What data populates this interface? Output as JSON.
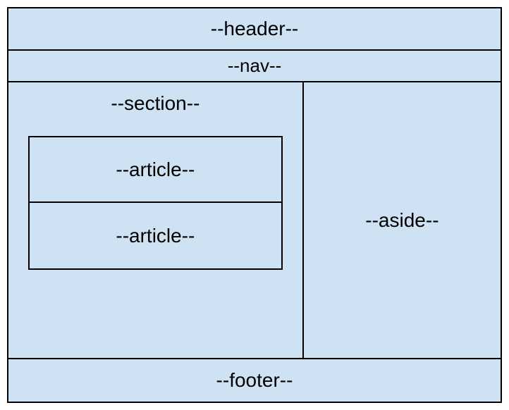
{
  "layout": {
    "header": "--header--",
    "nav": "--nav--",
    "section": {
      "title": "--section--",
      "articles": [
        "--article--",
        "--article--"
      ]
    },
    "aside": "--aside--",
    "footer": "--footer--"
  },
  "colors": {
    "fill": "#cfe2f3",
    "border": "#000000"
  }
}
